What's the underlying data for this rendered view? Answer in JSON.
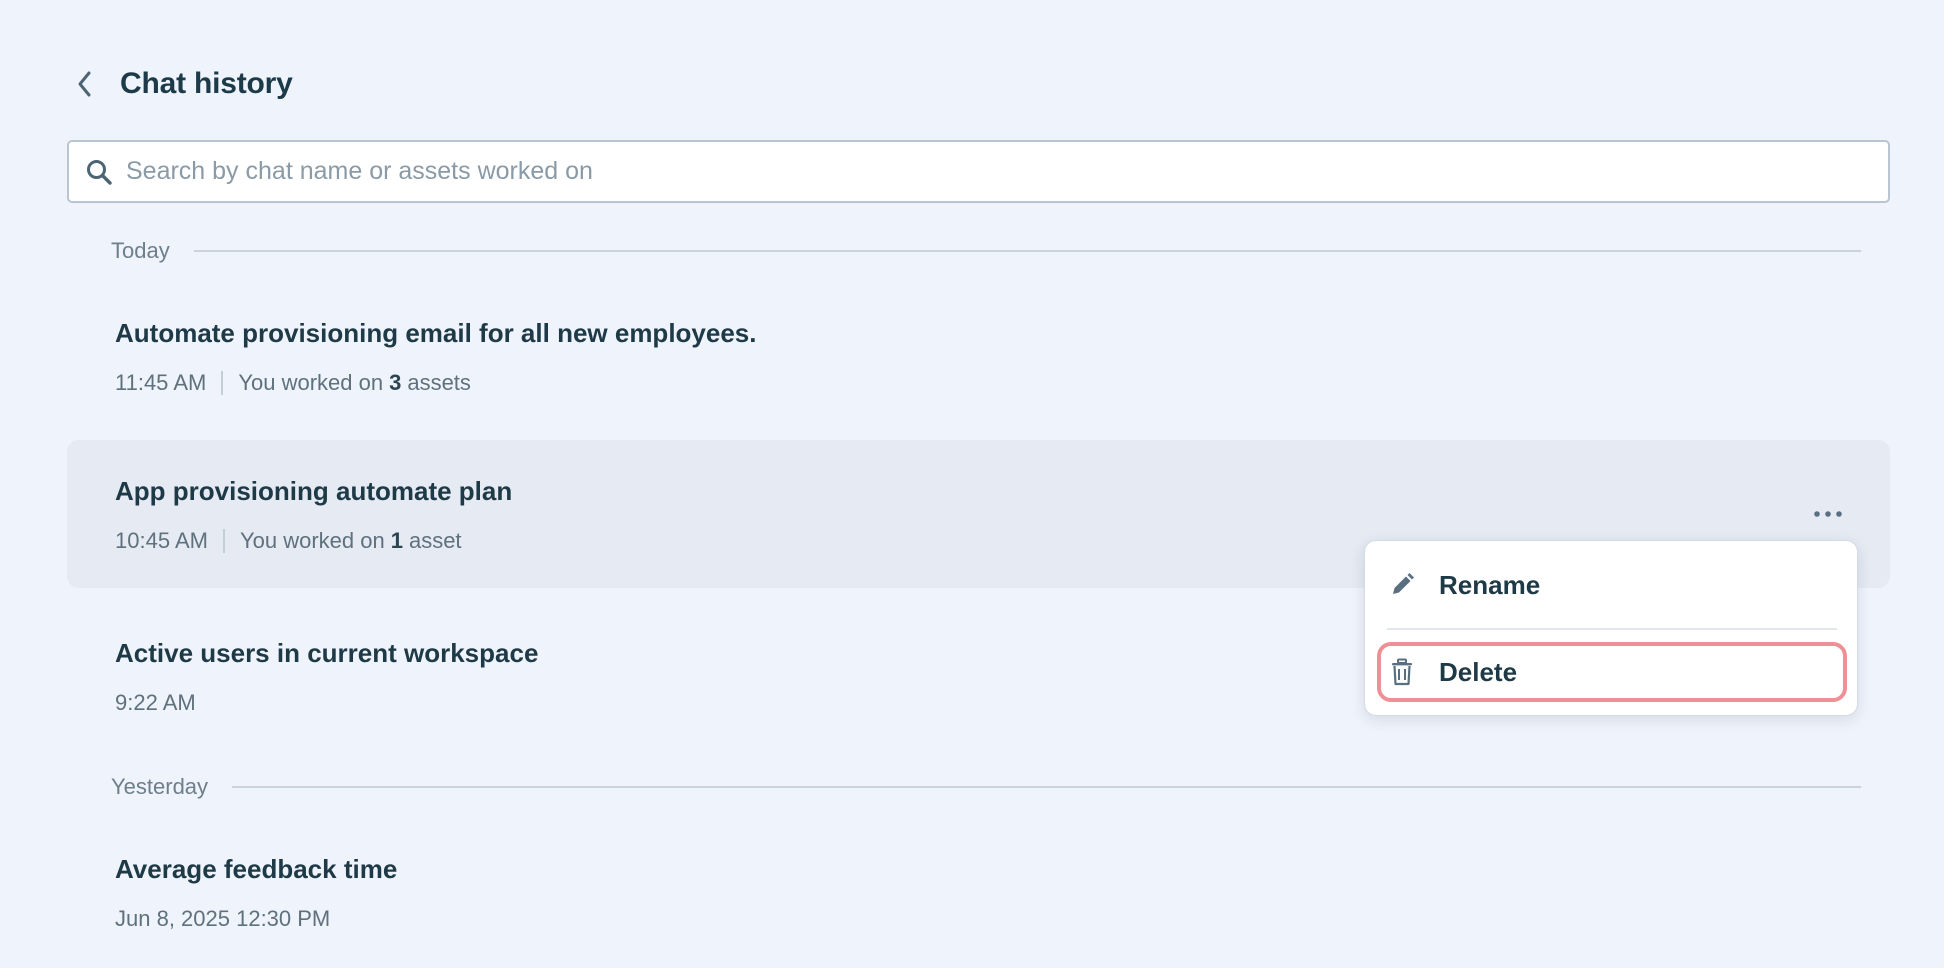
{
  "header": {
    "back_icon": "chevron-left-icon",
    "title": "Chat history"
  },
  "search": {
    "icon": "search-icon",
    "placeholder": "Search by chat name or assets worked on",
    "value": ""
  },
  "sections": [
    {
      "label": "Today",
      "items": [
        {
          "title": "Automate provisioning email for all new employees.",
          "time": "11:45 AM",
          "assets_prefix": "You worked on",
          "assets_count": "3",
          "assets_suffix": "assets"
        },
        {
          "title": "App provisioning automate plan",
          "time": "10:45 AM",
          "assets_prefix": "You worked on",
          "assets_count": "1",
          "assets_suffix": "asset",
          "hovered": true
        },
        {
          "title": "Active users in current workspace",
          "time": "9:22 AM"
        }
      ]
    },
    {
      "label": "Yesterday",
      "items": [
        {
          "title": "Average feedback time",
          "time": "Jun 8, 2025 12:30 PM"
        }
      ]
    }
  ],
  "context_menu": {
    "rename_label": "Rename",
    "rename_icon": "pencil-icon",
    "delete_label": "Delete",
    "delete_icon": "trash-icon",
    "more_icon": "more-horizontal-icon"
  },
  "colors": {
    "background": "#eff3fb",
    "hover_row": "#e5eaf3",
    "title_text": "#1f3a47",
    "delete_highlight": "#ef8f96"
  }
}
